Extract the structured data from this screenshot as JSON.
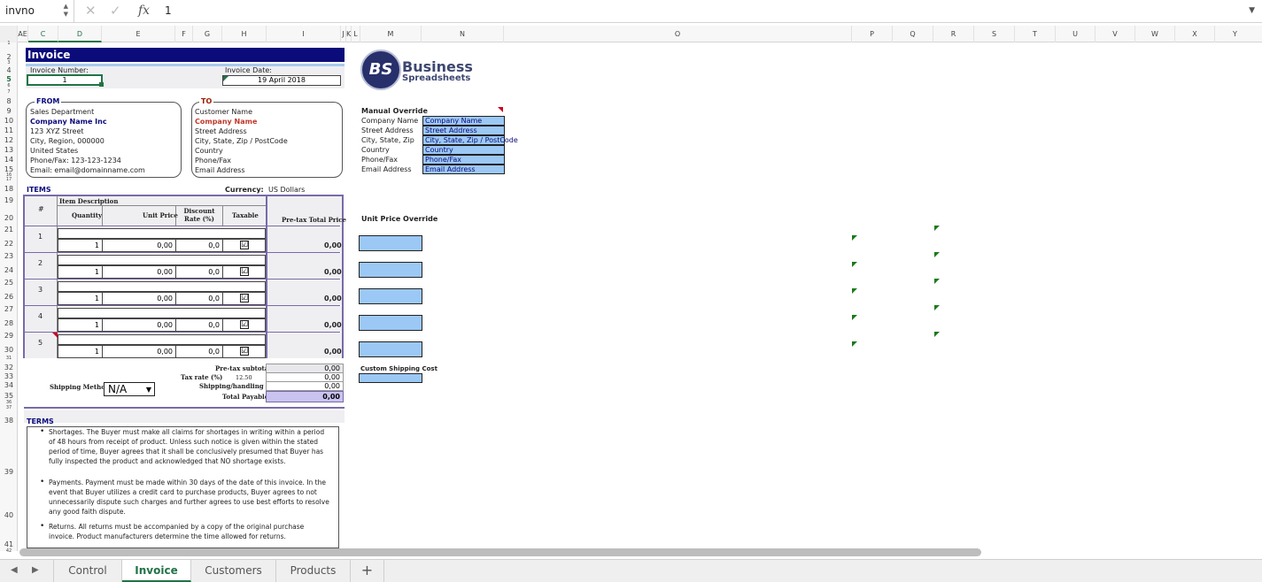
{
  "formula_bar": {
    "name_box": "invno",
    "value": "1"
  },
  "columns": [
    "AE",
    "C",
    "D",
    "E",
    "F",
    "G",
    "H",
    "I",
    "J",
    "K",
    "L",
    "M",
    "N",
    "O",
    "P",
    "Q",
    "R",
    "S",
    "T",
    "U",
    "V",
    "W",
    "X",
    "Y"
  ],
  "rows": [
    "1",
    "2",
    "3",
    "4",
    "5",
    "6",
    "7",
    "8",
    "9",
    "10",
    "11",
    "12",
    "13",
    "14",
    "15",
    "16",
    "17",
    "18",
    "19",
    "20",
    "21",
    "22",
    "23",
    "24",
    "25",
    "26",
    "27",
    "28",
    "29",
    "30",
    "31",
    "32",
    "33",
    "34",
    "35",
    "36",
    "37",
    "38",
    "39",
    "40",
    "41",
    "42"
  ],
  "invoice": {
    "title": "Invoice",
    "number_label": "Invoice Number:",
    "number": "1",
    "date_label": "Invoice Date:",
    "date": "19 April 2018"
  },
  "from": {
    "label": "FROM",
    "lines": [
      "Sales Department",
      "Company Name Inc",
      "123 XYZ Street",
      "City, Region, 000000",
      "United States",
      "Phone/Fax: 123-123-1234",
      "Email: email@domainname.com"
    ]
  },
  "to": {
    "label": "TO",
    "lines": [
      "Customer Name",
      "Company Name",
      "Street Address",
      "City, State, Zip / PostCode",
      "Country",
      "Phone/Fax",
      "Email Address"
    ]
  },
  "logo": {
    "initials": "BS",
    "line1": "Business",
    "line2": "Spreadsheets"
  },
  "manual_override": {
    "title": "Manual Override",
    "labels": [
      "Company Name",
      "Street Address",
      "City, State, Zip",
      "Country",
      "Phone/Fax",
      "Email Address"
    ],
    "values": [
      "Company Name",
      "Street Address",
      "City, State, Zip / PostCode",
      "Country",
      "Phone/Fax",
      "Email Address"
    ]
  },
  "items": {
    "label": "ITEMS",
    "currency_label": "Currency:",
    "currency": "US Dollars",
    "headers": {
      "num": "#",
      "desc": "Item Description",
      "qty": "Quantity",
      "price": "Unit Price",
      "disc": "Discount Rate (%)",
      "tax": "Taxable",
      "total": "Pre-tax Total Price"
    },
    "rows": [
      {
        "n": "1",
        "qty": "1",
        "price": "0,00",
        "disc": "0,0",
        "check": "☑",
        "total": "0,00"
      },
      {
        "n": "2",
        "qty": "1",
        "price": "0,00",
        "disc": "0,0",
        "check": "☑",
        "total": "0,00"
      },
      {
        "n": "3",
        "qty": "1",
        "price": "0,00",
        "disc": "0,0",
        "check": "☑",
        "total": "0,00"
      },
      {
        "n": "4",
        "qty": "1",
        "price": "0,00",
        "disc": "0,0",
        "check": "☑",
        "total": "0,00"
      },
      {
        "n": "5",
        "qty": "1",
        "price": "0,00",
        "disc": "0,0",
        "check": "☑",
        "total": "0,00"
      }
    ]
  },
  "unit_price_override": "Unit Price Override",
  "custom_shipping": "Custom Shipping Cost",
  "totals": {
    "shipping_method_label": "Shipping Method",
    "shipping_method": "N/A",
    "subtotal_label": "Pre-tax subtotal",
    "subtotal": "0,00",
    "tax_label": "Tax rate (%)",
    "tax_rate": "12.50",
    "tax": "0,00",
    "ship_label": "Shipping/handling cost",
    "ship": "0,00",
    "total_label": "Total Payable",
    "total": "0,00"
  },
  "terms": {
    "label": "TERMS",
    "items": [
      "Shortages. The Buyer must make all claims for shortages in writing within a period of 48 hours from receipt of product. Unless such notice is given within the stated period of time, Buyer agrees that it shall be conclusively presumed that Buyer has fully inspected the product and acknowledged that NO shortage exists.",
      "Payments. Payment must be made within 30 days of the date of this invoice. In the event that Buyer utilizes a credit card to purchase products, Buyer agrees to not unnecessarily dispute such charges and further agrees to use best efforts to resolve any good faith dispute.",
      "Returns. All returns must be accompanied by a copy of the original purchase invoice. Product manufacturers determine the time allowed for returns."
    ]
  },
  "sheet_tabs": [
    "Control",
    "Invoice",
    "Customers",
    "Products"
  ],
  "add_sheet": "+",
  "colors": {
    "accent": "#217346",
    "header_bar": "#0b0b7a",
    "override_fill": "#9cc8f5",
    "table_border": "#7a6aa8",
    "total_fill": "#c9c3f0"
  }
}
